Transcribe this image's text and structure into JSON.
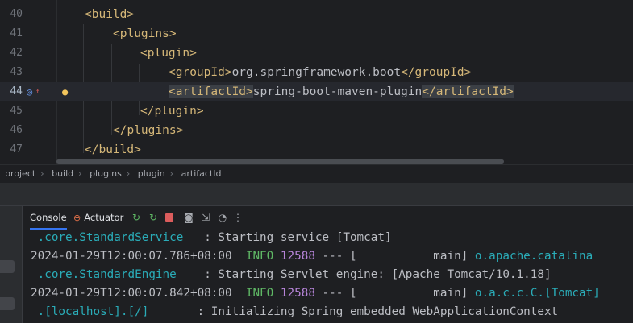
{
  "editor": {
    "lines": [
      {
        "num": "40",
        "open": "<",
        "tag": "build",
        "close": ">",
        "text": "",
        "etag": "",
        "indent": 1
      },
      {
        "num": "41",
        "open": "<",
        "tag": "plugins",
        "close": ">",
        "text": "",
        "etag": "",
        "indent": 2
      },
      {
        "num": "42",
        "open": "<",
        "tag": "plugin",
        "close": ">",
        "text": "",
        "etag": "",
        "indent": 3
      },
      {
        "num": "43",
        "open": "<",
        "tag": "groupId",
        "close": ">",
        "text": "org.springframework.boot",
        "etag": "</groupId>",
        "indent": 4
      },
      {
        "num": "44",
        "open": "<",
        "tag": "artifactId",
        "close": ">",
        "text": "spring-boot-maven-plugin",
        "etag": "</artifactId>",
        "indent": 4
      },
      {
        "num": "45",
        "open": "</",
        "tag": "plugin",
        "close": ">",
        "text": "",
        "etag": "",
        "indent": 3
      },
      {
        "num": "46",
        "open": "</",
        "tag": "plugins",
        "close": ">",
        "text": "",
        "etag": "",
        "indent": 2
      },
      {
        "num": "47",
        "open": "</",
        "tag": "build",
        "close": ">",
        "text": "",
        "etag": "",
        "indent": 1
      }
    ],
    "current_line": "44",
    "gutter_icons": {
      "run": "target-arrow-icon",
      "intention": "lightbulb-icon"
    }
  },
  "breadcrumb": [
    "project",
    "build",
    "plugins",
    "plugin",
    "artifactId"
  ],
  "tool_window": {
    "tabs": [
      {
        "label": "Console",
        "active": true
      },
      {
        "label": "Actuator",
        "active": false
      }
    ],
    "toolbar_icons": [
      "refresh-icon",
      "refresh-endpoint-icon",
      "stop-icon",
      "screenshot-icon",
      "import-icon",
      "redeploy-icon",
      "more-icon"
    ]
  },
  "console": {
    "lines": [
      {
        "ts": "",
        "level": "",
        "pid": "",
        "sep": "",
        "thread": "",
        "logger": " .core.StandardService",
        "msg": "   : Starting service [Tomcat]"
      },
      {
        "ts": "2024-01-29T12:00:07.786+08:00",
        "level": "INFO",
        "pid": "12588",
        "sep": " --- [           main] ",
        "logger": "o.apache.catalina",
        "msg": ""
      },
      {
        "ts": "",
        "level": "",
        "pid": "",
        "sep": "",
        "thread": "",
        "logger": " .core.StandardEngine",
        "msg": "    : Starting Servlet engine: [Apache Tomcat/10.1.18]"
      },
      {
        "ts": "2024-01-29T12:00:07.842+08:00",
        "level": "INFO",
        "pid": "12588",
        "sep": " --- [           main] ",
        "logger": "o.a.c.c.C.[Tomcat]",
        "msg": ""
      },
      {
        "ts": "",
        "level": "",
        "pid": "",
        "sep": "",
        "thread": "",
        "logger": " .[localhost].[/]",
        "msg": "       : Initializing Spring embedded WebApplicationContext"
      }
    ]
  }
}
